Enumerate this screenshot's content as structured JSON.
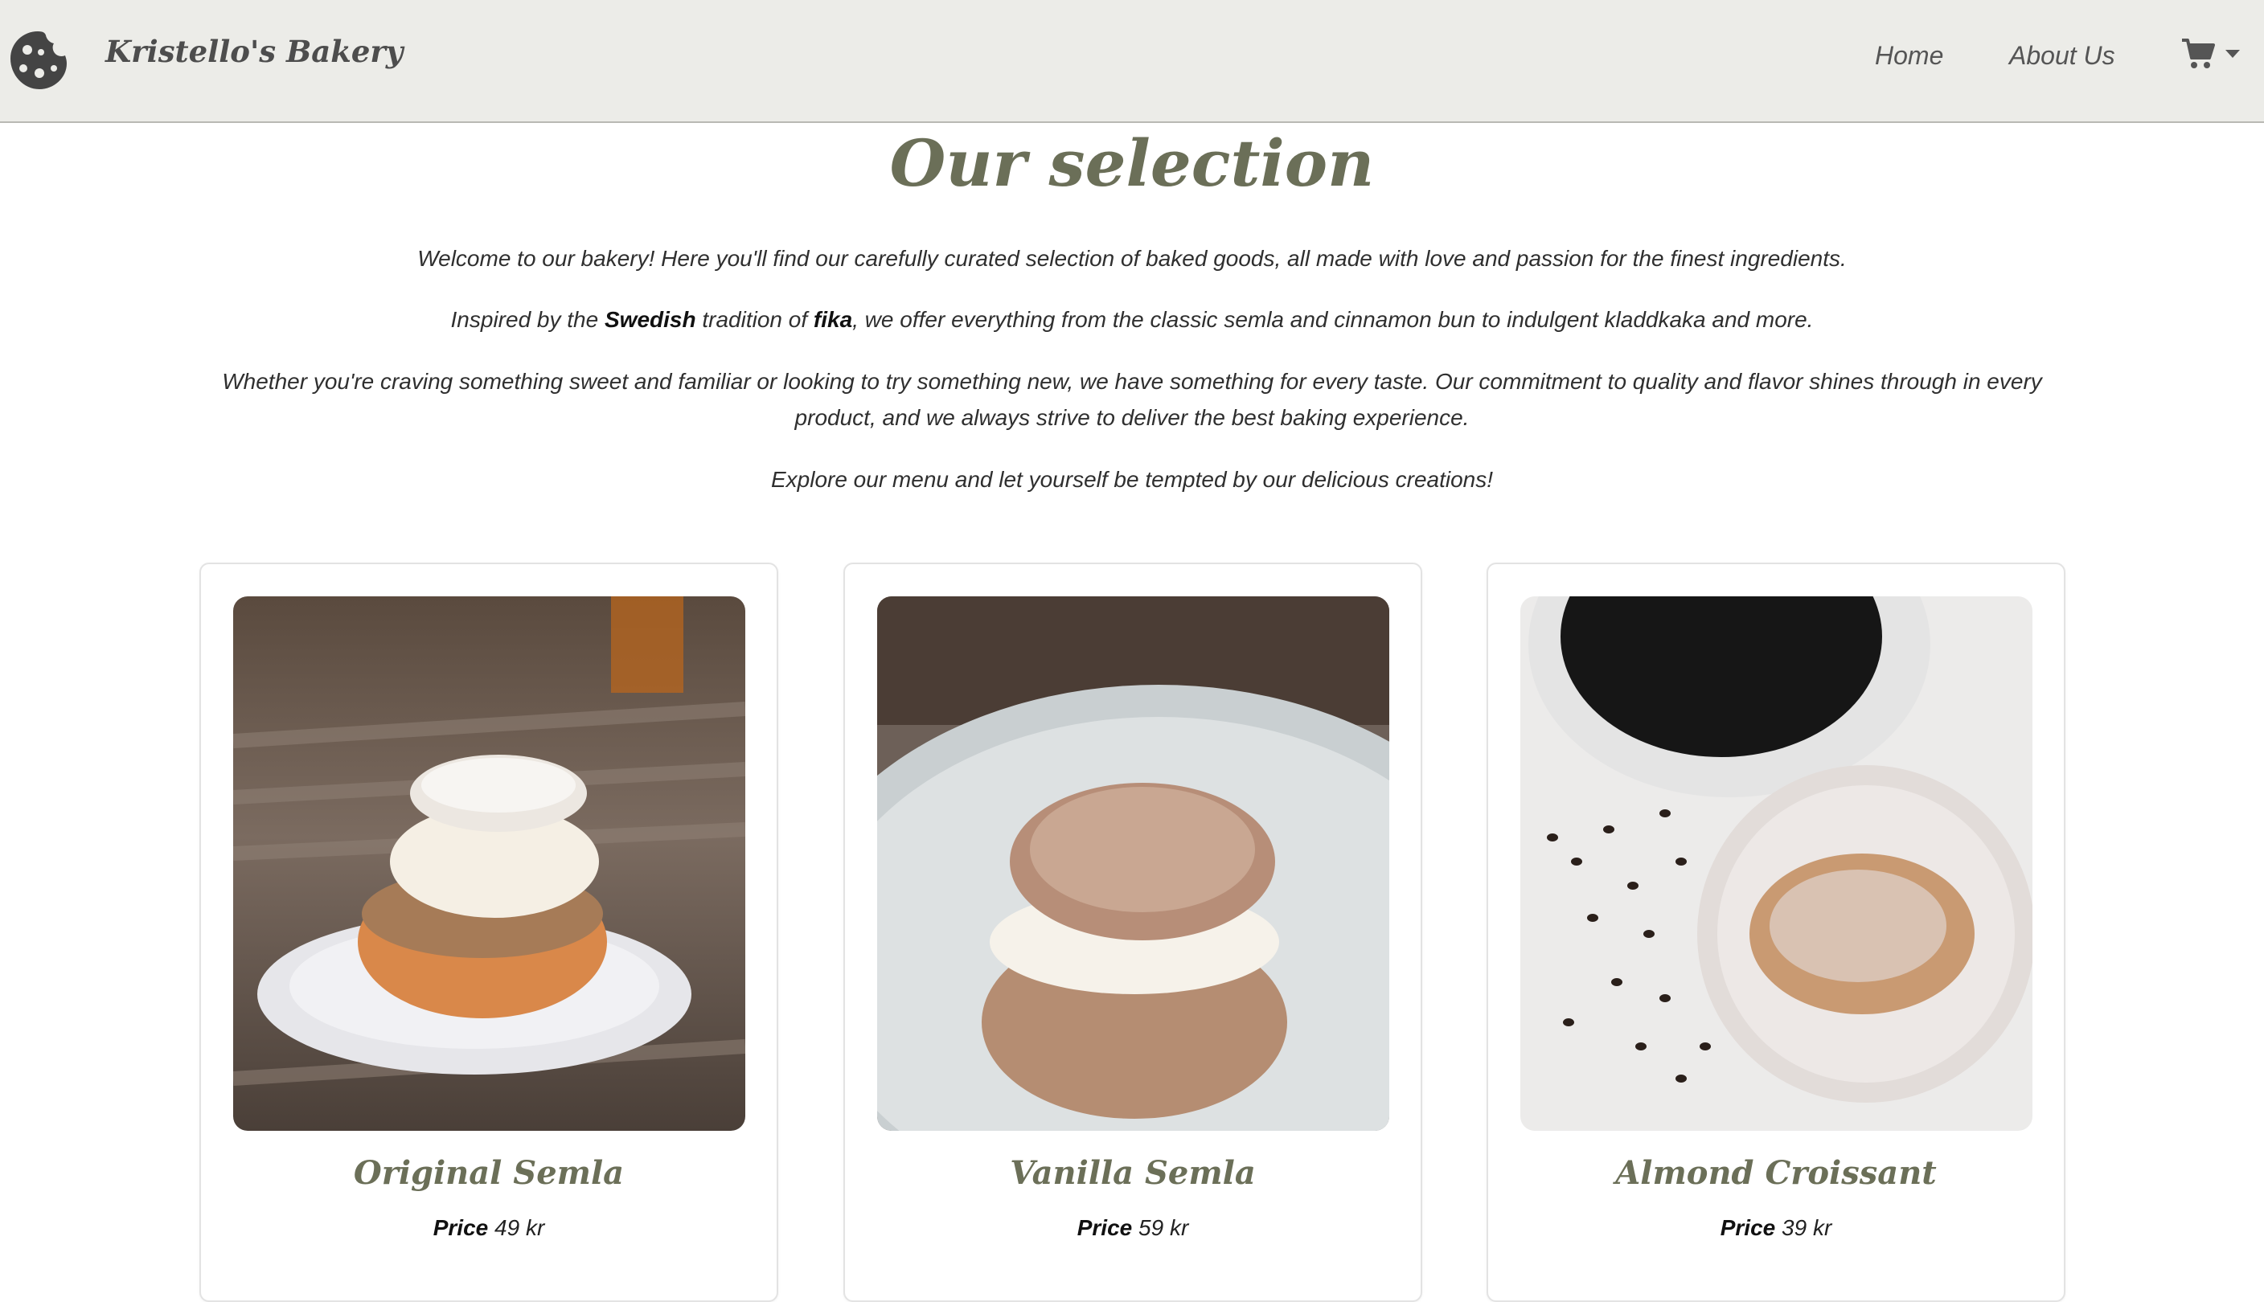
{
  "navbar": {
    "brand": "Kristello's Bakery",
    "logo_icon": "cookie-icon",
    "links": {
      "home": "Home",
      "about": "About Us"
    },
    "cart_icon": "shopping-cart-icon",
    "cart_caret_icon": "caret-down-icon",
    "background": "#ecece8"
  },
  "main": {
    "title": "Our selection",
    "intro_1": "Welcome to our bakery! Here you'll find our carefully curated selection of baked goods, all made with love and passion for the finest ingredients.",
    "intro_2": {
      "part1": "Inspired by the ",
      "bold1": "Swedish",
      "part2": " tradition of ",
      "bold2": "fika",
      "part3": ", we offer everything from the classic semla and cinnamon bun to indulgent kladdkaka and more."
    },
    "intro_3": "Whether you're craving something sweet and familiar or looking to try something new, we have something for every taste. Our commitment to quality and flavor shines through in every product, and we always strive to deliver the best baking experience.",
    "intro_4": "Explore our menu and let yourself be tempted by our delicious creations!",
    "accent_color": "#6b6f58"
  },
  "products": [
    {
      "name": "Original Semla",
      "price_label": "Price",
      "price": "49 kr",
      "image": "original-semla-photo"
    },
    {
      "name": "Vanilla Semla",
      "price_label": "Price",
      "price": "59 kr",
      "image": "vanilla-semla-photo"
    },
    {
      "name": "Almond Croissant",
      "price_label": "Price",
      "price": "39 kr",
      "image": "almond-croissant-photo"
    }
  ]
}
